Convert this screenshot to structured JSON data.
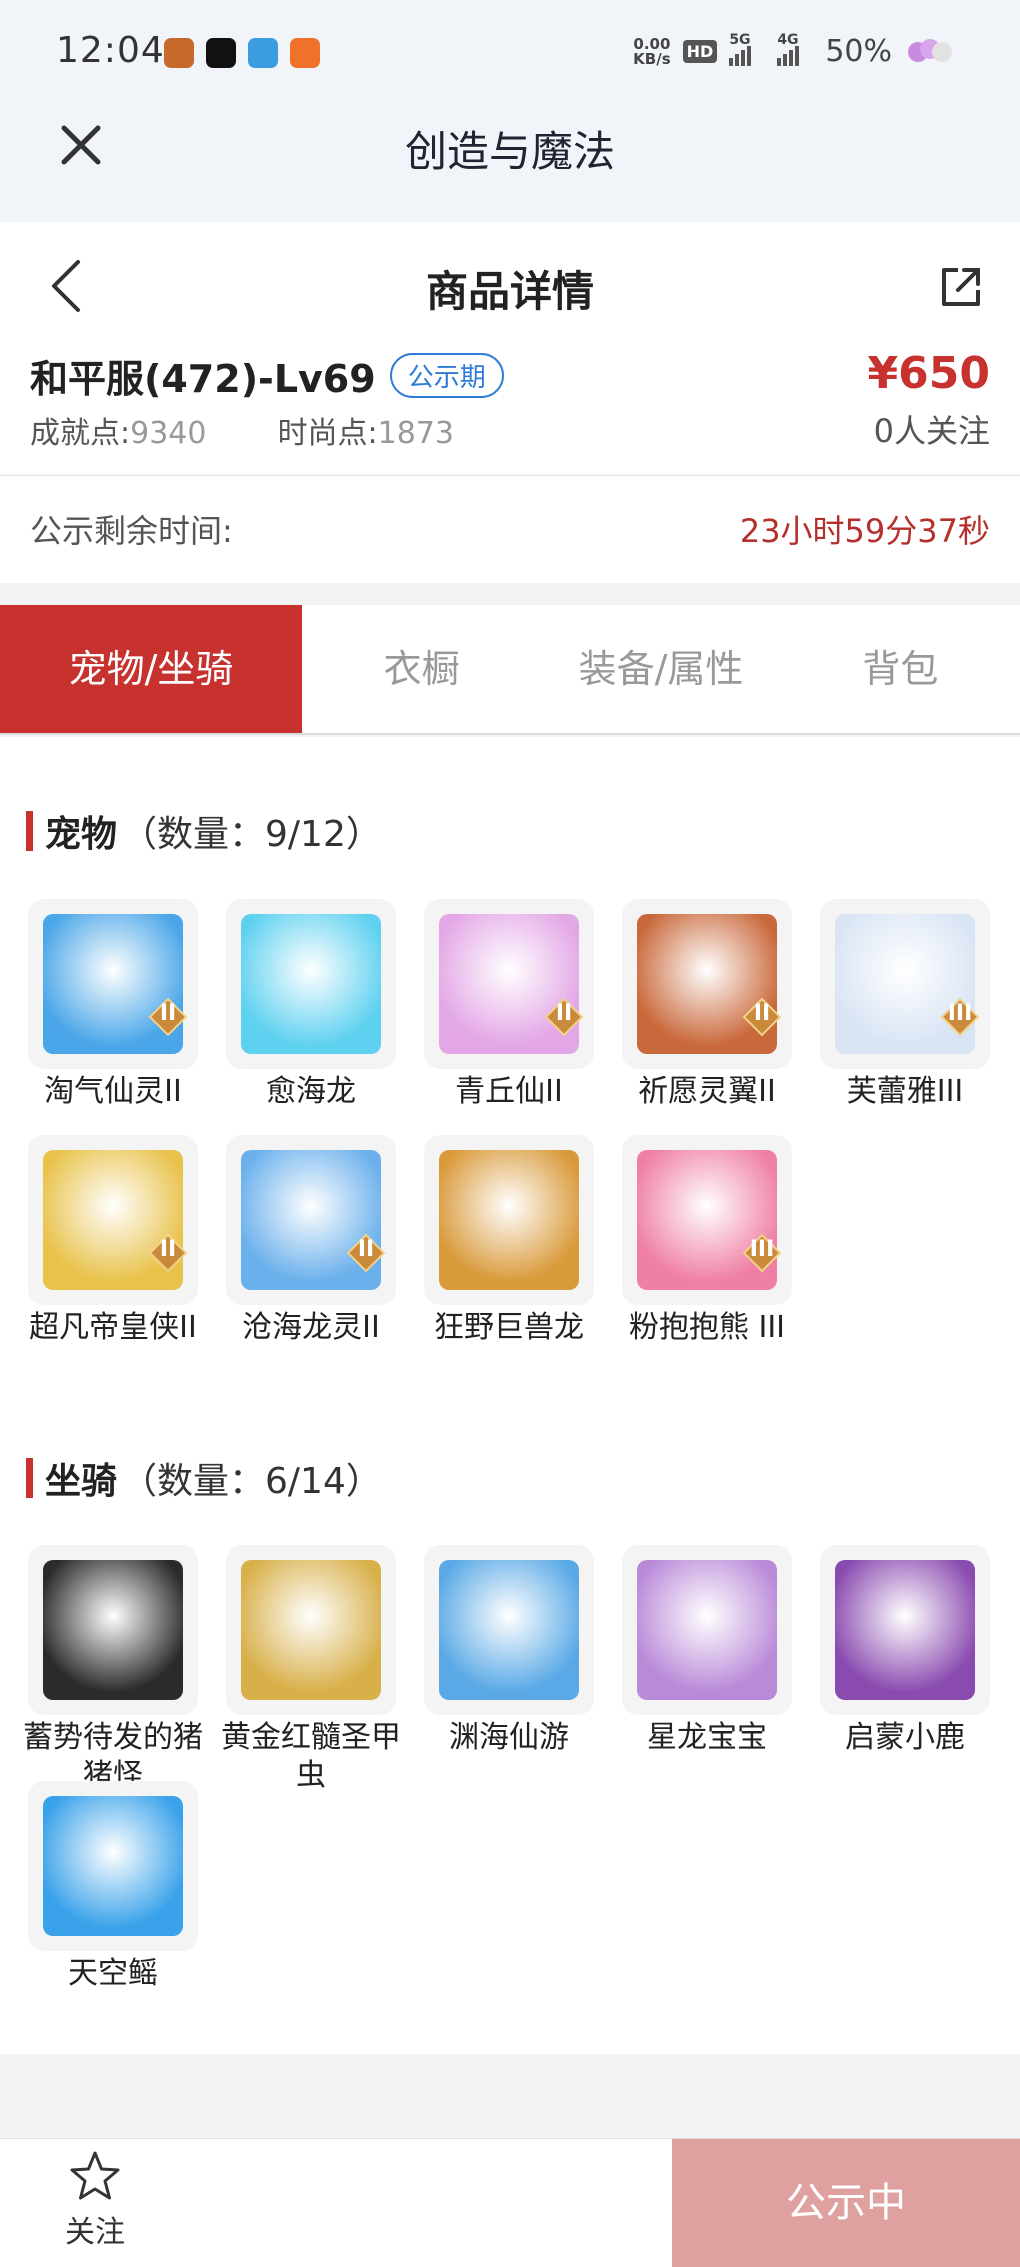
{
  "status_bar": {
    "time": "12:04",
    "net_speed_value": "0.00",
    "net_speed_unit": "KB/s",
    "hd_label": "HD",
    "signal_1": "5G",
    "signal_2": "4G",
    "battery": "50%"
  },
  "app_title": "创造与魔法",
  "page": {
    "title": "商品详情",
    "account_name": "和平服(472)-Lv69",
    "badge": "公示期",
    "achievement_label": "成就点:",
    "achievement_value": "9340",
    "fashion_label": "时尚点:",
    "fashion_value": "1873",
    "price": "¥650",
    "followers": "0人关注",
    "countdown_label": "公示剩余时间:",
    "countdown_value": "23小时59分37秒"
  },
  "tabs": [
    "宠物/坐骑",
    "衣橱",
    "装备/属性",
    "背包"
  ],
  "pets": {
    "title": "宠物",
    "count": "（数量：9/12）",
    "items": [
      {
        "name": "淘气仙灵II",
        "level": "II",
        "icon": "blue-dog-pet-icon",
        "color": "#4aa6e8"
      },
      {
        "name": "愈海龙",
        "level": "",
        "icon": "sea-dragon-pet-icon",
        "color": "#5fd1f0"
      },
      {
        "name": "青丘仙II",
        "level": "II",
        "icon": "fox-fairy-pet-icon",
        "color": "#e3a6e6"
      },
      {
        "name": "祈愿灵翼II",
        "level": "II",
        "icon": "eagle-pet-icon",
        "color": "#c9683a"
      },
      {
        "name": "芙蕾雅III",
        "level": "III",
        "icon": "valkyrie-pet-icon",
        "color": "#d9e4f4"
      },
      {
        "name": "超凡帝皇侠II",
        "level": "II",
        "icon": "golden-knight-pet-icon",
        "color": "#e8c24a"
      },
      {
        "name": "沧海龙灵II",
        "level": "II",
        "icon": "dragon-spirit-pet-icon",
        "color": "#6ab0ec"
      },
      {
        "name": "狂野巨兽龙",
        "level": "",
        "icon": "wild-beast-dragon-pet-icon",
        "color": "#d99a3a"
      },
      {
        "name": "粉抱抱熊 III",
        "level": "III",
        "icon": "pink-bear-pet-icon",
        "color": "#ef7fa5"
      }
    ]
  },
  "mounts": {
    "title": "坐骑",
    "count": "（数量：6/14）",
    "items": [
      {
        "name": "蓄势待发的猪猪怪",
        "level": "",
        "icon": "black-pig-mount-icon",
        "color": "#2b2b2b"
      },
      {
        "name": "黄金红髓圣甲虫",
        "level": "",
        "icon": "golden-beetle-mount-icon",
        "color": "#d8b04a"
      },
      {
        "name": "渊海仙游",
        "level": "",
        "icon": "abyss-rider-mount-icon",
        "color": "#5aa9e6"
      },
      {
        "name": "星龙宝宝",
        "level": "",
        "icon": "star-dragon-mount-icon",
        "color": "#b98ad8"
      },
      {
        "name": "启蒙小鹿",
        "level": "",
        "icon": "white-deer-mount-icon",
        "color": "#8a4bb0"
      },
      {
        "name": "天空鳐",
        "level": "",
        "icon": "sky-ray-mount-icon",
        "color": "#3aa2ea"
      }
    ]
  },
  "bottom": {
    "follow_label": "关注",
    "status_button": "公示中"
  },
  "colors": {
    "accent": "#c7322f",
    "badge_blue": "#2e7cd6",
    "status_button": "#dea19f"
  }
}
